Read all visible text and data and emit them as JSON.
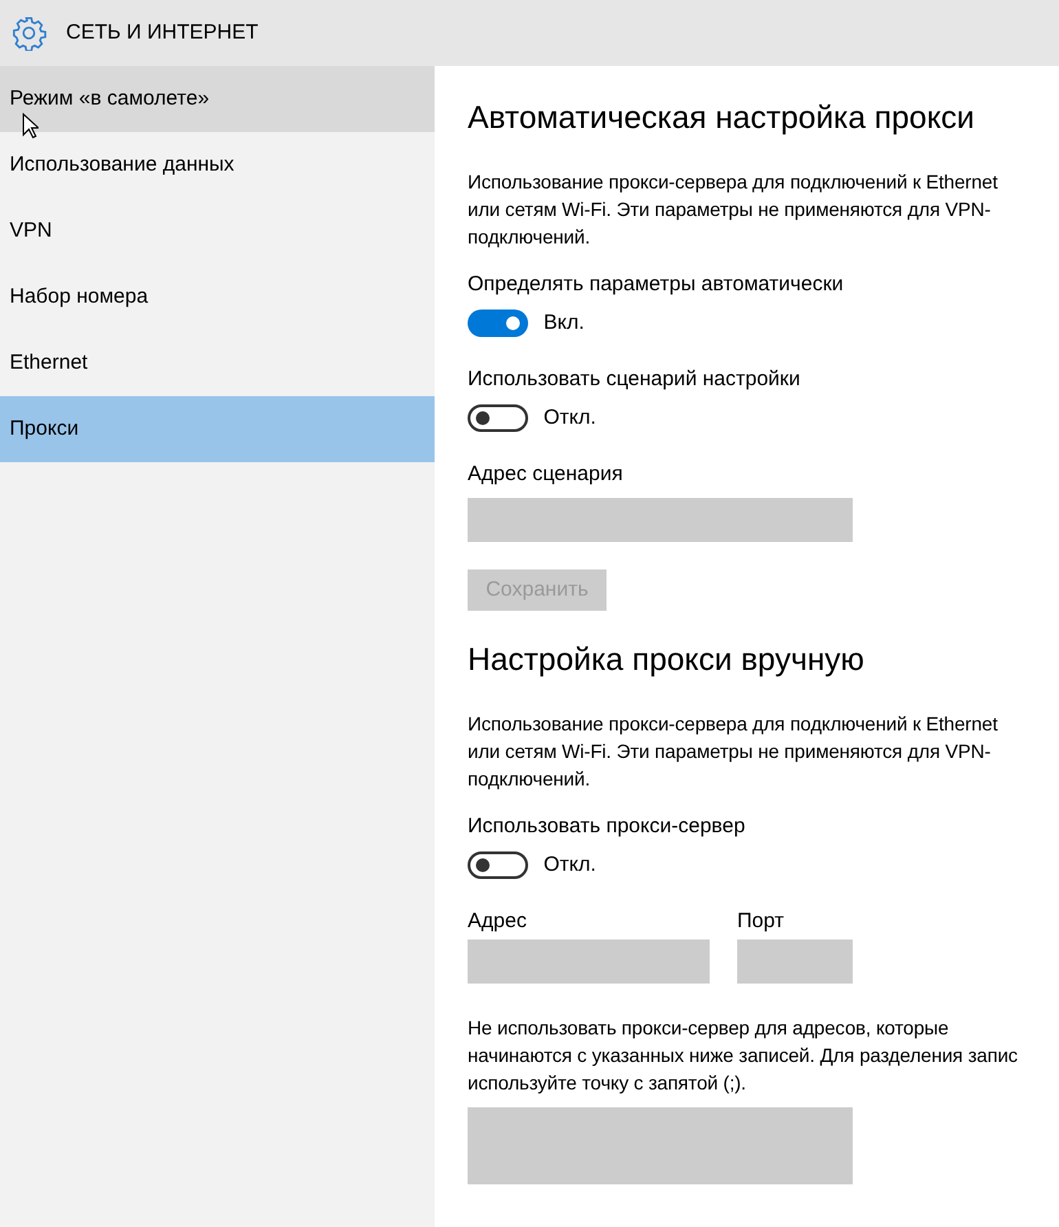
{
  "header": {
    "title": "СЕТЬ И ИНТЕРНЕТ"
  },
  "sidebar": {
    "items": [
      {
        "label": "Режим «в самолете»",
        "selected": false,
        "hovered": true
      },
      {
        "label": "Использование данных",
        "selected": false,
        "hovered": false
      },
      {
        "label": "VPN",
        "selected": false,
        "hovered": false
      },
      {
        "label": "Набор номера",
        "selected": false,
        "hovered": false
      },
      {
        "label": "Ethernet",
        "selected": false,
        "hovered": false
      },
      {
        "label": "Прокси",
        "selected": true,
        "hovered": false
      }
    ]
  },
  "sections": [
    {
      "heading": "Автоматическая настройка прокси",
      "items": [
        {
          "kind": "text",
          "lines": [
            "Использование прокси-сервера для подключений к Ethernet",
            "или сетям Wi-Fi. Эти параметры не применяются для VPN-",
            "подключений."
          ]
        },
        {
          "kind": "toggle",
          "label": "Определять параметры автоматически",
          "on": true,
          "state_text": "Вкл."
        },
        {
          "kind": "toggle",
          "label": "Использовать сценарий настройки",
          "on": false,
          "state_text": "Откл."
        },
        {
          "kind": "field",
          "label": "Адрес сценария",
          "disabled": true
        },
        {
          "kind": "button",
          "label": "Сохранить",
          "disabled": true
        }
      ]
    },
    {
      "heading": "Настройка прокси вручную",
      "items": [
        {
          "kind": "text",
          "lines": [
            "Использование прокси-сервера для подключений к Ethernet",
            "или сетям Wi-Fi. Эти параметры не применяются для VPN-",
            "подключений."
          ]
        },
        {
          "kind": "toggle",
          "label": "Использовать прокси-сервер",
          "on": false,
          "state_text": "Откл."
        },
        {
          "kind": "fields",
          "fields": [
            {
              "label": "Адрес",
              "disabled": true
            },
            {
              "label": "Порт",
              "disabled": true
            }
          ]
        },
        {
          "kind": "text",
          "lines": [
            "Не использовать прокси-сервер для адресов, которые",
            "начинаются с указанных ниже записей. Для разделения запис",
            "используйте точку с запятой (;)."
          ]
        },
        {
          "kind": "textarea",
          "disabled": true
        }
      ]
    }
  ]
}
